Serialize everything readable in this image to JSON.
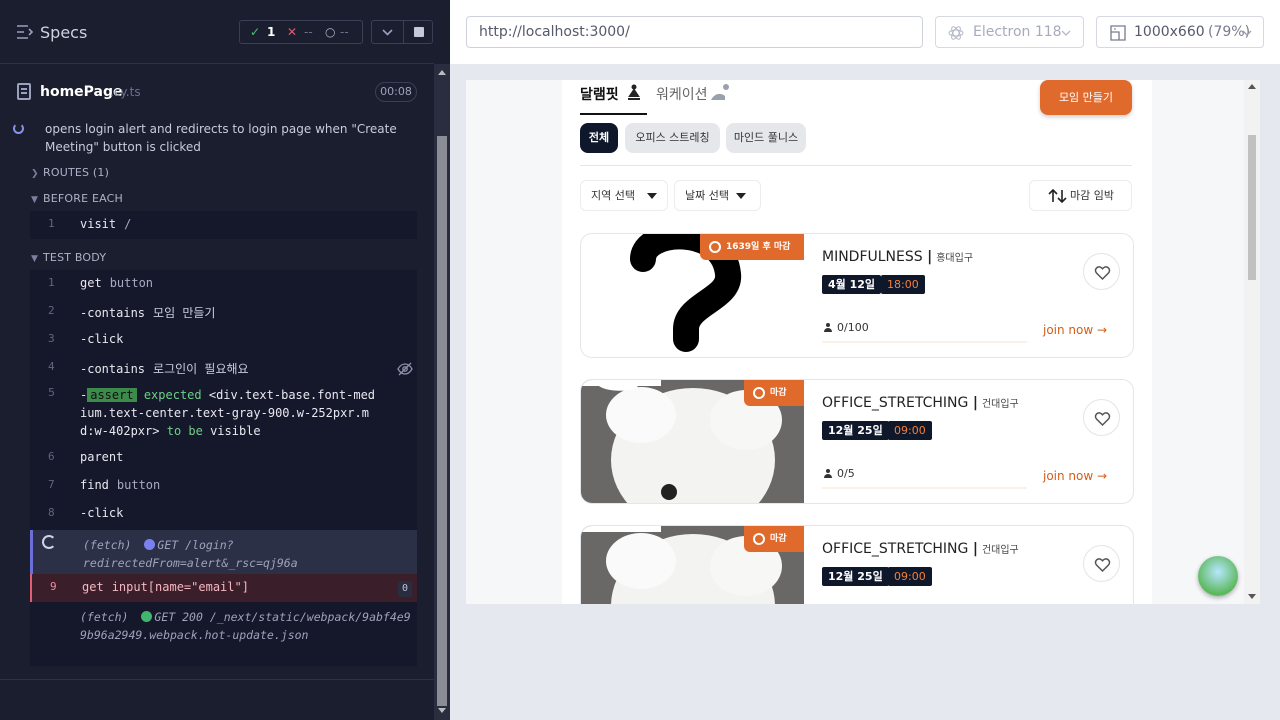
{
  "reporter": {
    "title": "Specs",
    "stats": {
      "passed": "1",
      "failed": "--",
      "pending": "--"
    },
    "file": {
      "name": "homePage",
      "ext": ".cy.ts",
      "duration": "00:08"
    },
    "test_title": "opens login alert and redirects to login page when \"Create Meeting\" button is clicked",
    "sections": {
      "routes": "ROUTES (1)",
      "before_each": "BEFORE EACH",
      "test_body": "TEST BODY"
    },
    "before_each": [
      {
        "num": "1",
        "cmd": "visit",
        "arg": "/"
      }
    ],
    "commands": [
      {
        "num": "1",
        "cmd": "get",
        "arg": "button"
      },
      {
        "num": "2",
        "cmd": "-contains",
        "arg": "모임 만들기"
      },
      {
        "num": "3",
        "cmd": "-click",
        "arg": ""
      },
      {
        "num": "4",
        "cmd": "-contains",
        "arg": "로그인이 필요해요"
      },
      {
        "num": "6",
        "cmd": "parent",
        "arg": ""
      },
      {
        "num": "7",
        "cmd": "find",
        "arg": "button"
      },
      {
        "num": "8",
        "cmd": "-click",
        "arg": ""
      }
    ],
    "assert_line": {
      "num": "5",
      "badge": "assert",
      "expected": "expected",
      "selector": "<div.text-base.font-medium.text-center.text-gray-900.w-252pxr.md:w-402pxr>",
      "to_be": "to be",
      "visible": "visible"
    },
    "fetch1": {
      "label": "(fetch)",
      "method": "GET",
      "url": "/login?redirectedFrom=alert&_rsc=qj96a"
    },
    "line9": {
      "num": "9",
      "cmd": "get",
      "arg": "input[name=\"email\"]",
      "count": "0"
    },
    "fetch2": {
      "label": "(fetch)",
      "method": "GET",
      "status": "200",
      "url": "/_next/static/webpack/9abf4e99b96a2949.webpack.hot-update.json"
    }
  },
  "runner": {
    "url": "http://localhost:3000/",
    "browser": "Electron 118",
    "viewport": "1000x660",
    "scale": "(79%)"
  },
  "app": {
    "tabs": [
      "달램핏",
      "워케이션"
    ],
    "create_button": "모임 만들기",
    "chips": [
      "전체",
      "오피스 스트레칭",
      "마인드 풀니스"
    ],
    "filters": {
      "region": "지역 선택",
      "date": "날짜 선택",
      "sort": "마감 임박"
    },
    "cards": [
      {
        "badge": "1639일 후 마감",
        "title": "MINDFULNESS",
        "location": "홍대입구",
        "date": "4월 12일",
        "time": "18:00",
        "people": "0/100",
        "progress": 0,
        "join": "join now"
      },
      {
        "badge": "마감",
        "title": "OFFICE_STRETCHING",
        "location": "건대입구",
        "date": "12월 25일",
        "time": "09:00",
        "people": "0/5",
        "progress": 0,
        "join": "join now"
      },
      {
        "badge": "마감",
        "title": "OFFICE_STRETCHING",
        "location": "건대입구",
        "date": "12월 25일",
        "time": "09:00",
        "people": "",
        "progress": 0,
        "join": ""
      }
    ]
  },
  "colors": {
    "accent": "#e06a2c",
    "reporter_bg": "#1b1e2e",
    "chip_active": "#0f172a"
  },
  "icons": [
    "specs-icon",
    "check-icon",
    "x-icon",
    "pending-icon",
    "chevron-down-icon",
    "stop-icon",
    "file-icon",
    "eye-slash-icon",
    "heart-icon",
    "alarm-icon",
    "person-icon",
    "arrow-right-icon",
    "sort-icon",
    "electron-icon",
    "viewport-icon"
  ]
}
